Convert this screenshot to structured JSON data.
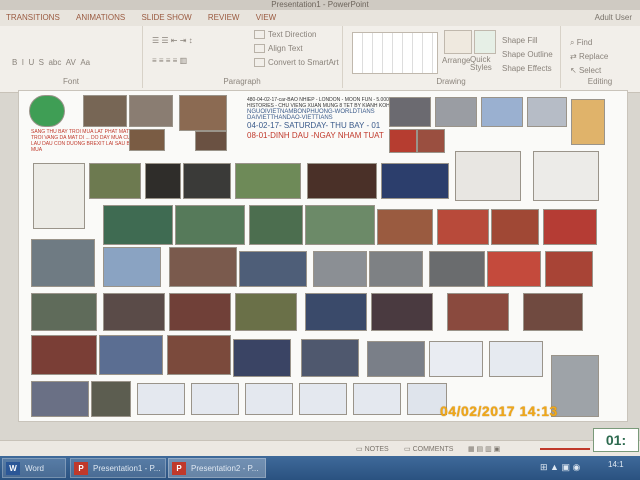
{
  "app": {
    "title": "Presentation1 - PowerPoint",
    "tabs": [
      "TRANSITIONS",
      "ANIMATIONS",
      "SLIDE SHOW",
      "REVIEW",
      "VIEW"
    ],
    "account": "Adult User"
  },
  "ribbon": {
    "groups": [
      "Font",
      "Paragraph",
      "Drawing",
      "Editing"
    ],
    "text_direction": "Text Direction",
    "align_text": "Align Text",
    "convert_smartart": "Convert to SmartArt",
    "arrange": "Arrange",
    "quick_styles": "Quick Styles",
    "shape_fill": "Shape Fill",
    "shape_outline": "Shape Outline",
    "shape_effects": "Shape Effects",
    "find": "Find",
    "replace": "Replace",
    "select": "Select"
  },
  "slide": {
    "header_line1": "480-04-02-17-car-BAO NHIEP - LONDON - MOON FUN - 5.000 YEAR",
    "header_line2": "HISTORIES - CHU VIENG XUAN MUNG 8 TET BY KIANH KOH",
    "site1": "NGUOIVIETNAMBONPHUONG-WORLDTIANS",
    "site2": "DAIVIETTHANDAO-VIETTIANS",
    "date_line1": "04-02-17- SATURDAY- THU BAY - 01",
    "date_line2": "08-01-DINH DAU -NGAY NHAM TUAT",
    "red_text": "SANG THU BAY TROI MUA LAT PHAT MAT TROI VANG DA MAT DI ... DO DAY MUA CUC LAU DAU CON DUONG BREXIT LAI SAU BAN MUA"
  },
  "status": {
    "notes": "NOTES",
    "comments": "COMMENTS",
    "zoom_display": "01:"
  },
  "taskbar": {
    "items": [
      "Word",
      "Presentation1 - P...",
      "Presentation2 - P..."
    ],
    "clock": "14:1"
  },
  "overlay": {
    "camera_timestamp": "04/02/2017  14:13"
  },
  "colors": {
    "accent_red": "#c0392b",
    "timestamp": "#f0a818",
    "taskbar": "#2a5280"
  }
}
